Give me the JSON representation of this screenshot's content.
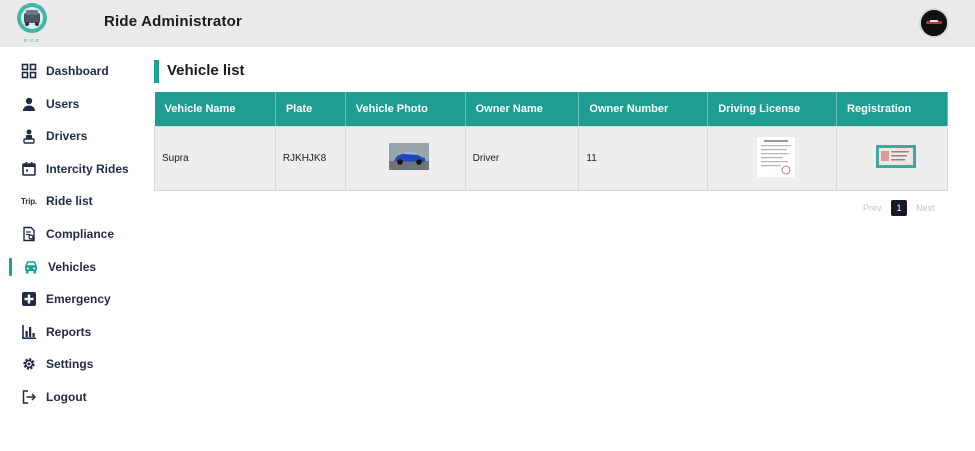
{
  "header": {
    "app_title": "Ride Administrator",
    "logo_caption": "RIDE"
  },
  "sidebar": {
    "items": [
      {
        "label": "Dashboard",
        "icon": "dashboard-icon"
      },
      {
        "label": "Users",
        "icon": "user-icon"
      },
      {
        "label": "Drivers",
        "icon": "driver-icon"
      },
      {
        "label": "Intercity Rides",
        "icon": "calendar-icon"
      },
      {
        "label": "Ride list",
        "icon": "trip-icon",
        "icon_text": "Trip."
      },
      {
        "label": "Compliance",
        "icon": "document-search-icon"
      },
      {
        "label": "Vehicles",
        "icon": "car-icon",
        "active": true
      },
      {
        "label": "Emergency",
        "icon": "medical-cross-icon"
      },
      {
        "label": "Reports",
        "icon": "bar-chart-icon"
      },
      {
        "label": "Settings",
        "icon": "gear-icon"
      },
      {
        "label": "Logout",
        "icon": "logout-icon"
      }
    ]
  },
  "main": {
    "title": "Vehicle list",
    "table": {
      "columns": [
        "Vehicle Name",
        "Plate",
        "Vehicle Photo",
        "Owner Name",
        "Owner Number",
        "Driving License",
        "Registration"
      ],
      "rows": [
        {
          "vehicle_name": "Supra",
          "plate": "RJKHJK8",
          "owner_name": "Driver",
          "owner_number": "11"
        }
      ]
    },
    "pagination": {
      "prev": "Prev",
      "current": "1",
      "next": "Next"
    }
  },
  "colors": {
    "accent": "#1e9d92",
    "topbar": "#eaeaea",
    "nav_text": "#1f2a44",
    "pager_active": "#141a2e"
  }
}
